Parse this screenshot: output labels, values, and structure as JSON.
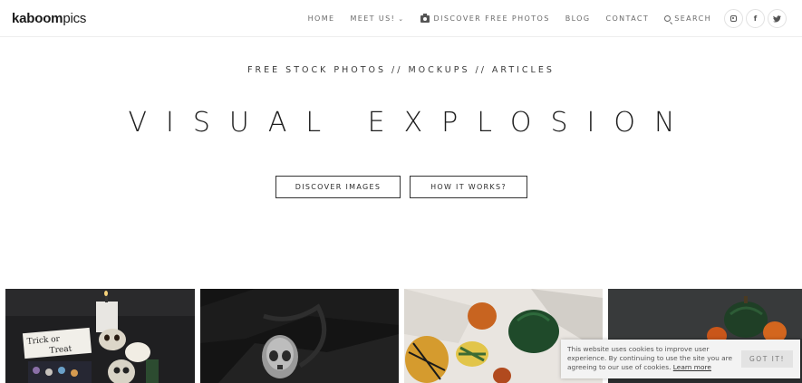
{
  "header": {
    "logo_bold": "kaboom",
    "logo_light": "pics",
    "nav": {
      "home": "HOME",
      "meet_us": "MEET US!",
      "meet_us_chevron": "⌄",
      "discover": "DISCOVER FREE PHOTOS",
      "blog": "BLOG",
      "contact": "CONTACT",
      "search": "SEARCH"
    },
    "social": {
      "facebook": "f",
      "twitter": "🐦"
    }
  },
  "hero": {
    "tagline": "FREE STOCK PHOTOS // MOCKUPS // ARTICLES",
    "title": "VISUAL EXPLOSION",
    "discover_button": "DISCOVER IMAGES",
    "how_button": "HOW IT WORKS?"
  },
  "gallery": {
    "photo1": {
      "sign_line1": "Trick or",
      "sign_line2": "Treat"
    }
  },
  "cookie": {
    "text": "This website uses cookies to improve user experience. By continuing to use the site you are agreeing to our use of cookies.",
    "link": "Learn more",
    "button": "GOT IT!"
  },
  "colors": {
    "accent_dark": "#1e1e1e",
    "nav_text": "#6a6a6a",
    "cookie_bg": "#f3f3f3"
  },
  "icons": [
    "camera-icon",
    "search-icon",
    "instagram-icon",
    "facebook-icon",
    "twitter-icon",
    "chevron-down-icon"
  ]
}
